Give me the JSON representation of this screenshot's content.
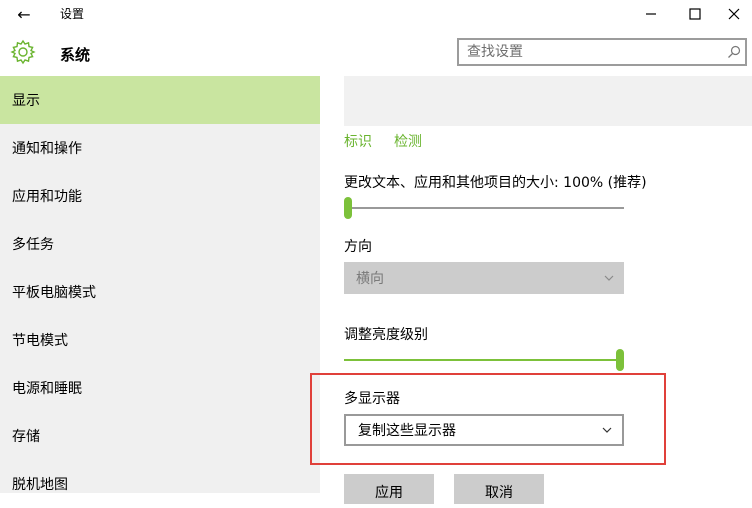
{
  "window": {
    "title": "设置",
    "back_icon": "←",
    "minimize_icon": "—",
    "maximize_icon": "☐",
    "close_icon": "✕"
  },
  "header": {
    "section_title": "系统",
    "search_placeholder": "查找设置"
  },
  "sidebar": {
    "items": [
      {
        "label": "显示",
        "active": true
      },
      {
        "label": "通知和操作"
      },
      {
        "label": "应用和功能"
      },
      {
        "label": "多任务"
      },
      {
        "label": "平板电脑模式"
      },
      {
        "label": "节电模式"
      },
      {
        "label": "电源和睡眠"
      },
      {
        "label": "存储"
      },
      {
        "label": "脱机地图"
      }
    ]
  },
  "display": {
    "identify_link": "标识",
    "detect_link": "检测",
    "scale_label": "更改文本、应用和其他项目的大小: 100% (推荐)",
    "scale_level": 0,
    "orientation_label": "方向",
    "orientation_value": "横向",
    "brightness_label": "调整亮度级别",
    "brightness_level": 1.0,
    "multi_display_label": "多显示器",
    "multi_display_value": "复制这些显示器",
    "apply_button": "应用",
    "cancel_button": "取消"
  },
  "colors": {
    "accent": "#7cc13a",
    "sidebar_active": "#c9e5a0",
    "highlight_border": "#e0403a"
  }
}
